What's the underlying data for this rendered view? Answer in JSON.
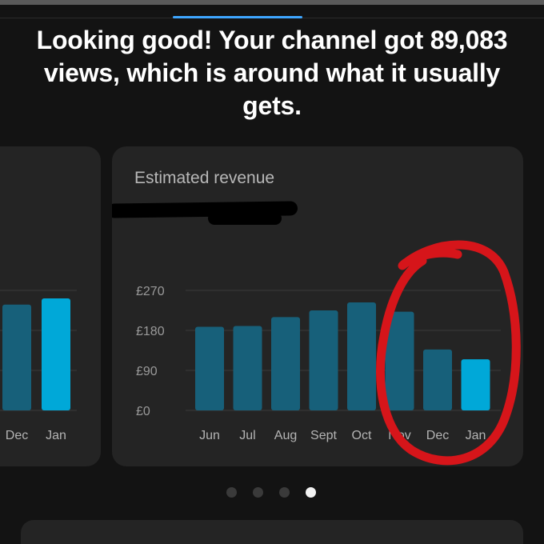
{
  "headline": "Looking good! Your channel got 89,083 views, which is around what it usually gets.",
  "revenue_card": {
    "title": "Estimated revenue",
    "value_redacted": true
  },
  "pagination": {
    "count": 4,
    "active_index": 3
  },
  "colors": {
    "bar": "#17607a",
    "bar_highlight": "#00a8d8",
    "annotation": "#d6151a",
    "accent": "#3ea6ff"
  },
  "chart_data": [
    {
      "type": "bar",
      "categories": [
        "Dec",
        "Jan"
      ],
      "values": [
        238,
        252
      ],
      "highlight_index": 1,
      "partial": true
    },
    {
      "type": "bar",
      "title": "Estimated revenue",
      "currency": "£",
      "categories": [
        "Jun",
        "Jul",
        "Aug",
        "Sept",
        "Oct",
        "Nov",
        "Dec",
        "Jan"
      ],
      "values": [
        188,
        190,
        210,
        225,
        243,
        222,
        137,
        115
      ],
      "highlight_index": 7,
      "yticks": [
        "£0",
        "£90",
        "£180",
        "£270"
      ],
      "ylim": [
        0,
        270
      ],
      "grid": true
    }
  ]
}
